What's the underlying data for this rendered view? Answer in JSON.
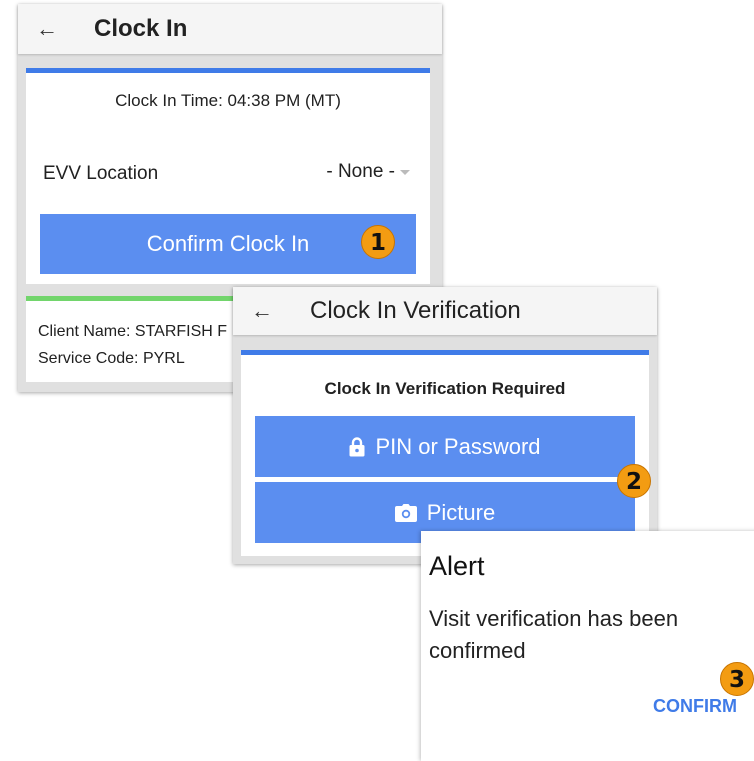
{
  "clock_in": {
    "title": "Clock In",
    "back_icon": "arrow-left-icon",
    "clock_in_time": "Clock In Time: 04:38 PM (MT)",
    "evv_label": "EVV Location",
    "evv_value": "- None -",
    "confirm_button": "Confirm Clock In",
    "client_name": "Client Name: STARFISH F",
    "service_code": "Service Code: PYRL"
  },
  "verification": {
    "title": "Clock In Verification",
    "back_icon": "arrow-left-icon",
    "required_title": "Clock In Verification Required",
    "pin_button": "PIN or Password",
    "pin_icon": "lock-icon",
    "picture_button": "Picture",
    "picture_icon": "camera-icon"
  },
  "alert": {
    "title": "Alert",
    "message": "Visit verification has been confirmed",
    "confirm": "CONFIRM"
  },
  "steps": [
    "1",
    "2",
    "3"
  ],
  "colors": {
    "accent_blue": "#3f7be8",
    "button_blue": "#5b8ef0",
    "success_green": "#72d56c",
    "step_badge": "#f39c12"
  }
}
